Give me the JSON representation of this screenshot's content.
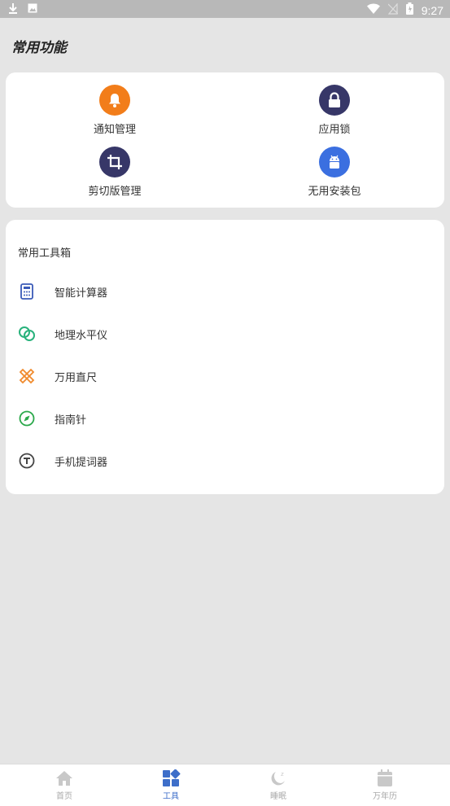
{
  "status_bar": {
    "time": "9:27"
  },
  "page": {
    "title": "常用功能"
  },
  "functions": [
    {
      "label": "通知管理",
      "icon": "bell-icon",
      "color": "#f27d1a"
    },
    {
      "label": "应用锁",
      "icon": "lock-icon",
      "color": "#373768"
    },
    {
      "label": "剪切版管理",
      "icon": "crop-icon",
      "color": "#373768"
    },
    {
      "label": "无用安装包",
      "icon": "android-icon",
      "color": "#3b6fe0"
    }
  ],
  "tools": {
    "header": "常用工具箱",
    "items": [
      {
        "label": "智能计算器",
        "icon": "calculator-icon",
        "color": "#3b5bb8"
      },
      {
        "label": "地理水平仪",
        "icon": "level-icon",
        "color": "#29b27c"
      },
      {
        "label": "万用直尺",
        "icon": "ruler-icon",
        "color": "#f08a2c"
      },
      {
        "label": "指南针",
        "icon": "compass-icon",
        "color": "#2aa84a"
      },
      {
        "label": "手机提词器",
        "icon": "teleprompter-icon",
        "color": "#444"
      }
    ]
  },
  "bottom_nav": {
    "items": [
      {
        "label": "首页",
        "icon": "home-icon"
      },
      {
        "label": "工具",
        "icon": "tools-icon"
      },
      {
        "label": "睡眠",
        "icon": "moon-icon"
      },
      {
        "label": "万年历",
        "icon": "calendar-icon"
      }
    ],
    "active_color": "#3d6ec9",
    "inactive_color": "#c8c8c8"
  }
}
